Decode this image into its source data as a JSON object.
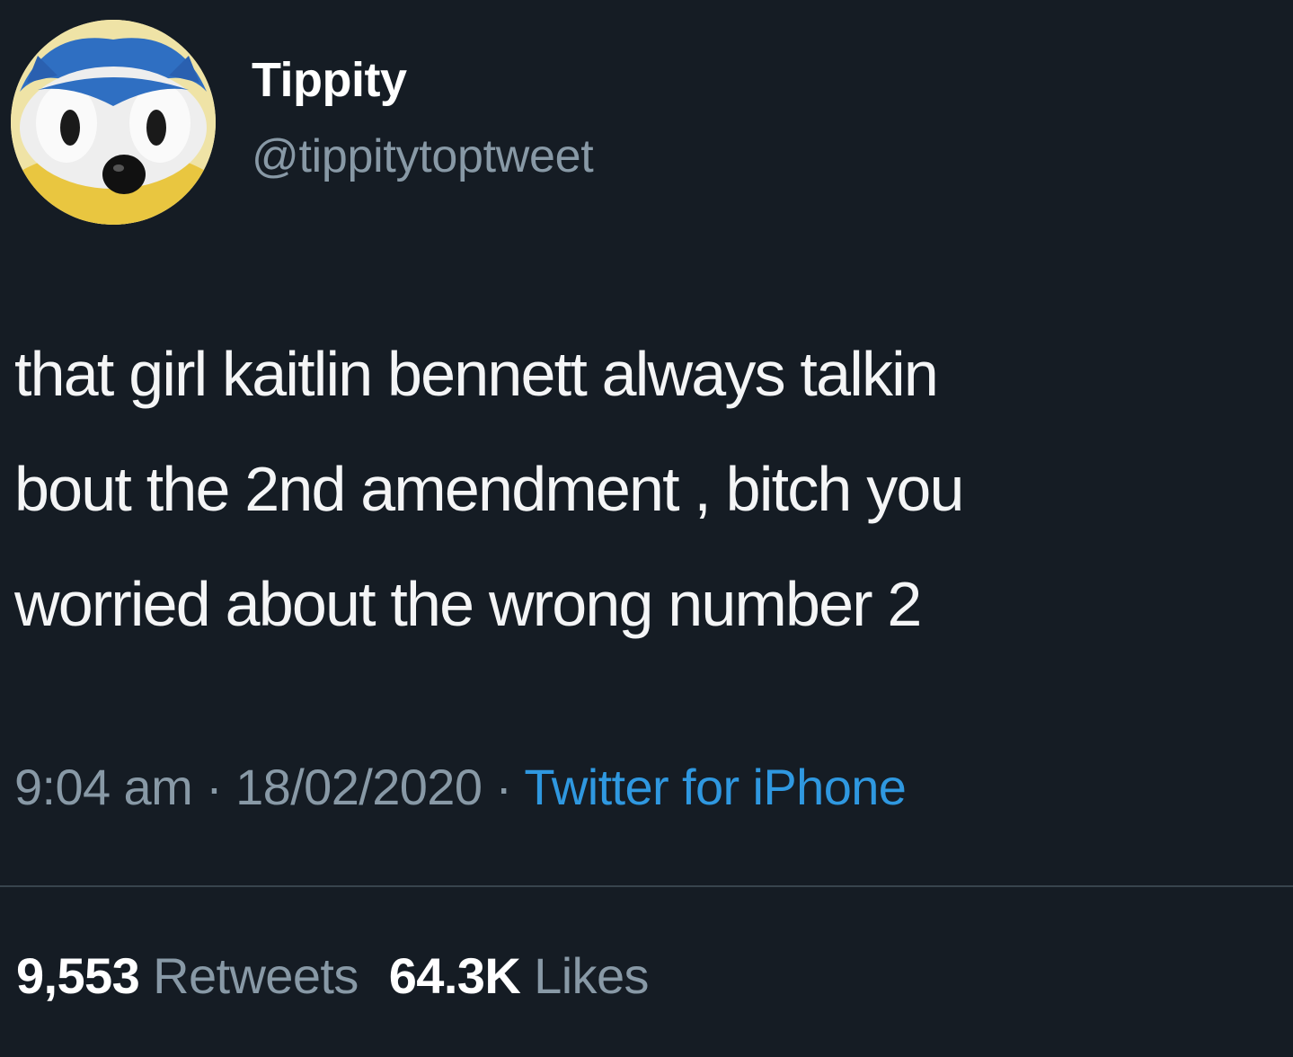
{
  "user": {
    "display_name": "Tippity",
    "handle": "@tippitytoptweet",
    "avatar_icon": "sonic-avatar-icon"
  },
  "tweet": {
    "lines": [
      "that girl kaitlin bennett always talkin",
      "bout the 2nd amendment , bitch you",
      "worried about the wrong number 2"
    ]
  },
  "meta": {
    "time": "9:04 am",
    "separator": " · ",
    "date": "18/02/2020",
    "source": "Twitter for iPhone"
  },
  "stats": {
    "retweets_count": "9,553",
    "retweets_label": "Retweets",
    "likes_count": "64.3K",
    "likes_label": "Likes"
  },
  "colors": {
    "background": "#151c24",
    "secondary_text": "#8899a6",
    "link": "#2f98e0",
    "divider": "#38444d"
  }
}
